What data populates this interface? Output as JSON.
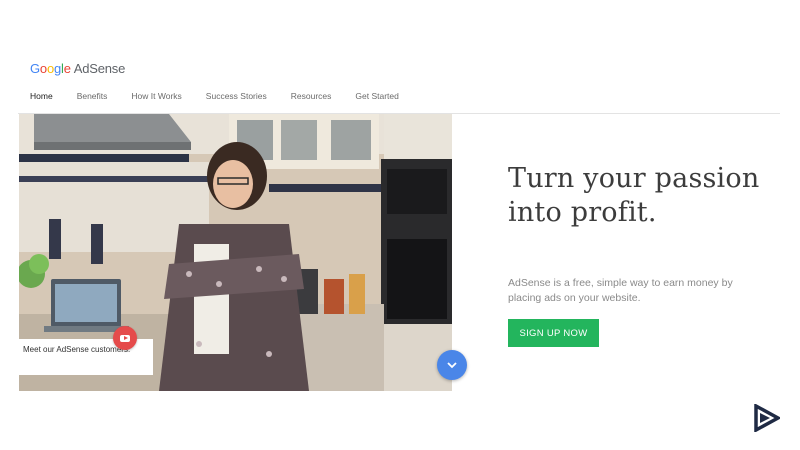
{
  "header": {
    "logo_google": "Google",
    "logo_product": "AdSense",
    "nav": [
      {
        "label": "Home"
      },
      {
        "label": "Benefits"
      },
      {
        "label": "How It Works"
      },
      {
        "label": "Success Stories"
      },
      {
        "label": "Resources"
      },
      {
        "label": "Get Started"
      }
    ]
  },
  "hero": {
    "caption": "Meet our AdSense customers.",
    "headline": "Turn your passion into profit.",
    "subtext": "AdSense is a free, simple way to earn money by placing ads on your website.",
    "cta_label": "SIGN UP NOW"
  },
  "icons": {
    "video_button": "youtube-play-icon",
    "scroll_button": "chevron-down-icon",
    "brand_mark": "play-triangle-logo-icon"
  },
  "colors": {
    "cta_green": "#23b55d",
    "scroll_blue": "#4a86e8",
    "video_red": "#e54b4b",
    "brand_navy": "#1f2a44"
  }
}
